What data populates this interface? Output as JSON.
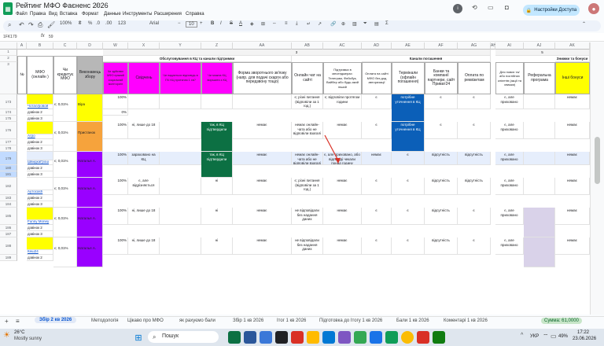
{
  "title": "Рейтинг МФО Фаєненс 2026",
  "menu": [
    "Файл",
    "Правка",
    "Вид",
    "Вставка",
    "Формат",
    "Данные",
    "Инструменты",
    "Расширения",
    "Справка"
  ],
  "share_label": "Настройки Доступа",
  "toolbar": {
    "zoom": "100%",
    "font": "Arial",
    "size": "10"
  },
  "cell_ref": "1FK179",
  "formula": "59",
  "columns": [
    "A",
    "B",
    "C",
    "D",
    "W",
    "X",
    "Y",
    "Z",
    "AA",
    "AB",
    "AC",
    "AD",
    "AE",
    "AF",
    "AG",
    "AH",
    "AI",
    "AJ",
    "AK"
  ],
  "headers": {
    "num": "№",
    "mfo": "МФО (онлайн )",
    "credit": "Чи кредитує МФО",
    "exec": "Виконавець збору",
    "group3": "3",
    "group_support": "Обслуговування в КЦ та канали підтримки",
    "group_channels": "Канали погашення",
    "group5": "5",
    "group_bonus": "Знижки та бонуси",
    "w": "Чи здійснює МФО прямий соціальний моніторинг",
    "x": "Свідчень",
    "y": "Чи надається відповідь в ПЧ КЦ протягом 1 хв?",
    "z": "Чи можна КЦ вирішити з КЦ",
    "aa": "Форма зворотнього зв'язку (напр. для подачі скарги або передзвону тощо)",
    "ab": "Онлайн чат на сайті",
    "ac": "Підтримка в месенджерах: Телеграм, Фейсбук, Вайбер або будь-який інший",
    "ad": "Оплата на сайті МФО без дод авторизації",
    "ae": "Термінали (офлайн погашення)",
    "af": "Банки та компанії партнери, сайт Приват24",
    "ag": "Оплата по реквізитам",
    "ai": "Для нових та/або постійних клієнтів (акції та знижки)",
    "aj": "Реферальна програма",
    "ak": "Інші бонуси"
  },
  "rows": [
    {
      "n": "173",
      "name": "Чотал/ровой",
      "pct": "є; 0,01%",
      "exec": "Віра",
      "w": "100%",
      "x": "",
      "y": "",
      "z": "",
      "aa": "",
      "ab": "є; різні питання (відповіли за 1 год.)",
      "ac": "є; відповіли протягом години",
      "ad": "є",
      "ae": "потрібне уточнення в КЦ",
      "af": "є",
      "ag": "є",
      "ai": "є, але приховано",
      "aj": "",
      "ak": "немає"
    },
    {
      "n": "174",
      "name": "дзвінок 2",
      "w": "0%"
    },
    {
      "n": "175",
      "name": "дзвінок 3"
    },
    {
      "n": "176",
      "name": "Агро",
      "pct": "є; 0,01%",
      "exec": "Пристанок",
      "w": "100%",
      "x": "ні, лише до 18",
      "z": "так, в КЦ підтвердили",
      "aa": "немає",
      "ab": "немає онлайн-чата або не відповіли взагалі",
      "ac": "немає",
      "ad": "є",
      "ae": "потрібне уточнення в КЦ",
      "af": "є",
      "ag": "є",
      "ai": "є, але приховано",
      "ak": "немає"
    },
    {
      "n": "177",
      "name": "дзвінок 2"
    },
    {
      "n": "178",
      "name": "дзвінок 3"
    },
    {
      "n": "179",
      "name": "ШвидкаГрош",
      "pct": "є; 0,01%",
      "exec": "Наталья А.",
      "w": "100%",
      "x": "зараховано на КЦ",
      "z": "так, в КЦ підтвердили",
      "aa": "немає",
      "ab": "немає онлайн-чата або не відповіли взагалі",
      "ac": "є, але приховано, або відповіді чекали понад годину",
      "ad": "немає",
      "ae": "є",
      "af": "відсутність",
      "ag": "відсутність",
      "ai": "є, але приховано",
      "ak": "немає"
    },
    {
      "n": "180",
      "name": "дзвінок 2"
    },
    {
      "n": "181",
      "name": "дзвінок 3"
    },
    {
      "n": "182",
      "name": "Аутоcash",
      "pct": "є; 0,01%",
      "exec": "Наталья А.",
      "w": "100%",
      "x": "є, але відрізняється",
      "z": "ні",
      "aa": "немає",
      "ab": "є; різні питання (відповіли за 1 год.)",
      "ac": "немає",
      "ad": "є",
      "ae": "є",
      "af": "відсутність",
      "ag": "відсутність",
      "ai": "є, але приховано",
      "ak": "немає"
    },
    {
      "n": "183",
      "name": "дзвінок 2"
    },
    {
      "n": "184",
      "name": "дзвінок 3"
    },
    {
      "n": "185",
      "name": "Funny Money",
      "pct": "є; 0,01%",
      "exec": "Наталья А.",
      "w": "100%",
      "x": "ні, лише до 18",
      "z": "ні",
      "aa": "немає",
      "ab": "не відповідали без надання даних",
      "ac": "немає",
      "ad": "є",
      "ae": "є",
      "af": "відсутність",
      "ag": "є",
      "ai": "є, але приховано",
      "ak": "немає"
    },
    {
      "n": "186",
      "name": "дзвінок 2"
    },
    {
      "n": "187",
      "name": "дзвінок 3"
    },
    {
      "n": "188",
      "name": "Кеш24",
      "pct": "є; 0,01%",
      "exec": "Наталья А.",
      "w": "100%",
      "x": "ні, лише до 18",
      "z": "ні",
      "aa": "немає",
      "ab": "не відповідали без надання даних",
      "ac": "немає",
      "ad": "є",
      "ae": "є",
      "af": "відсутність",
      "ag": "є",
      "ai": "є, але приховано",
      "ak": "немає"
    },
    {
      "n": "189",
      "name": "дзвінок 2"
    }
  ],
  "sheet_tabs": [
    "Збір 2 кв 2026",
    "Методологія",
    "Цікаво про МФО",
    "як рахуємо бали",
    "Збір 1 кв 2026",
    "Ітог 1 кв 2026",
    "Підготовка до Ітогу 1 кв 2026",
    "Бали 1 кв 2026",
    "Коментарі 1 кв 2026"
  ],
  "sum_label": "Сумма: 61,0000",
  "weather": {
    "temp": "26°C",
    "desc": "Mostly sunny"
  },
  "search": "Пошук",
  "tray": {
    "lang": "УКР",
    "battery": "49%",
    "time": "17:22",
    "date": "23.06.2026"
  },
  "colors": {
    "magenta": "#ff00ff",
    "yellow": "#ffff00",
    "orange": "#f6a33c",
    "purple": "#9900ff",
    "blue": "#0b5fb8",
    "green": "#0c7043",
    "lilac": "#d9d2e9",
    "cyan": "#00b0f0"
  }
}
